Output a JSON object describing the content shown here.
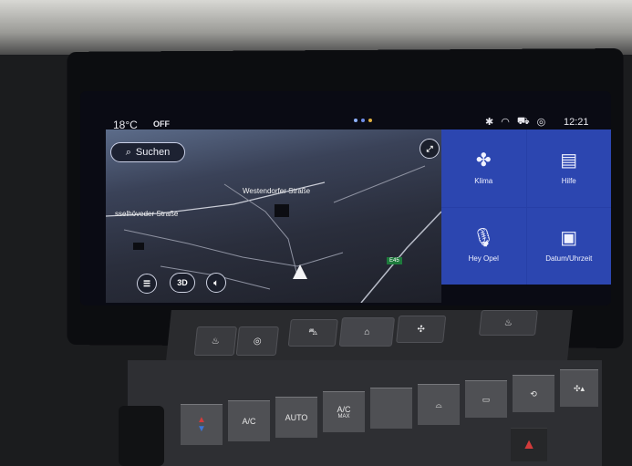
{
  "status_bar": {
    "temperature": "18°C",
    "climate_state": "OFF",
    "time": "12:21",
    "icons": [
      "bluetooth-icon",
      "wifi-icon",
      "car-icon",
      "location-icon"
    ]
  },
  "map": {
    "search_label": "Suchen",
    "street_labels": [
      "Westendorfer Straße",
      "sselhöveder Straße"
    ],
    "route_badge": "E45",
    "view_mode": "3D"
  },
  "tiles": [
    {
      "label": "Klima",
      "icon": "fan-temperature-icon"
    },
    {
      "label": "Hilfe",
      "icon": "manual-book-icon"
    },
    {
      "label": "Hey Opel",
      "icon": "microphone-icon"
    },
    {
      "label": "Datum/Uhrzeit",
      "icon": "calendar-clock-icon"
    }
  ],
  "hard_buttons": {
    "ac": "A/C",
    "auto": "AUTO",
    "ac_max_top": "A/C",
    "ac_max_bottom": "MAX"
  },
  "colors": {
    "tile_blue": "#2c46b0",
    "map_dark": "#2a2e3c",
    "badge_green": "#1e7a3c"
  }
}
